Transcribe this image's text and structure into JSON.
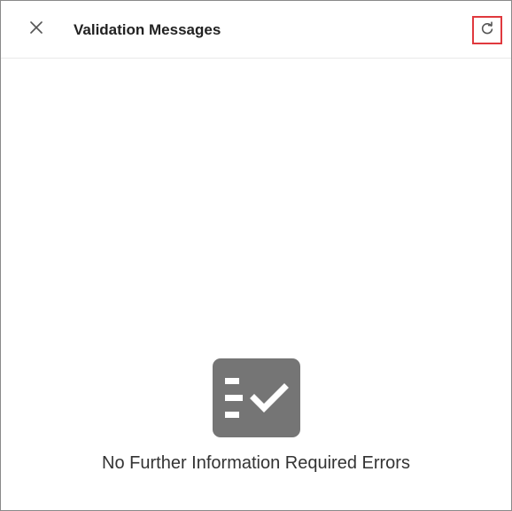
{
  "dialog": {
    "title": "Validation Messages",
    "close_icon": "close-icon",
    "refresh_icon": "refresh-icon"
  },
  "empty_state": {
    "icon": "checklist-icon",
    "message": "No Further Information Required Errors"
  },
  "colors": {
    "highlight_border": "#e0393e",
    "icon_fill": "#757575",
    "panel_border": "#8a8a8a"
  }
}
